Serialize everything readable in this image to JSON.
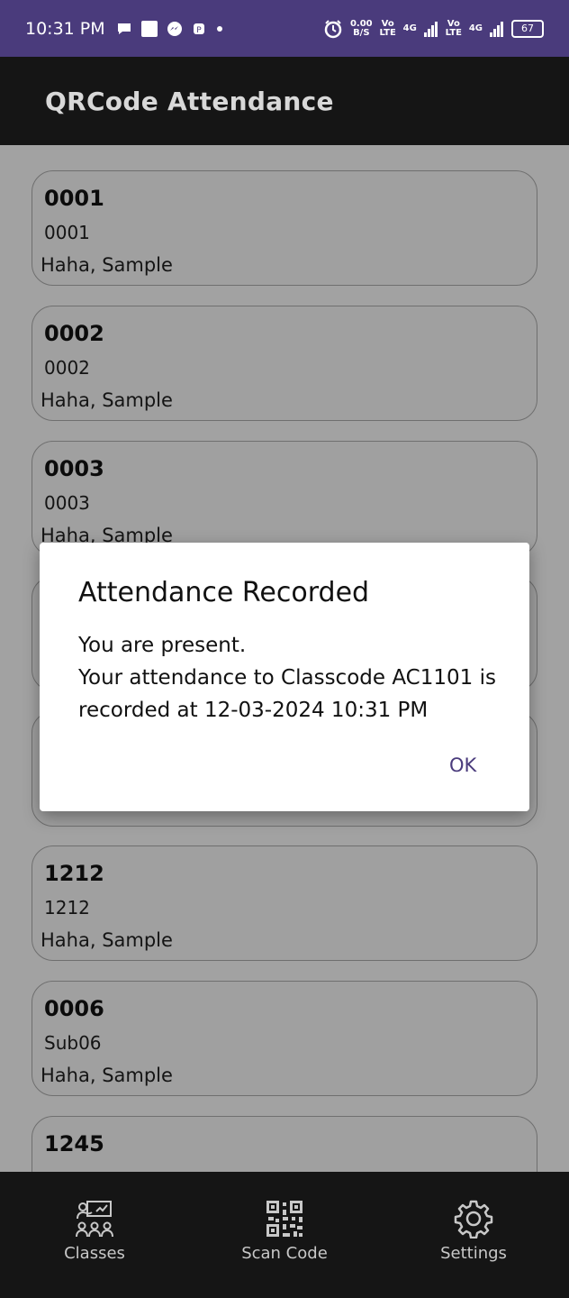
{
  "status_bar": {
    "time": "10:31 PM",
    "speed_value": "0.00",
    "speed_unit": "B/S",
    "volte1": "Vo LTE",
    "net1": "4G",
    "volte2": "Vo LTE",
    "net2": "4G",
    "battery": "67"
  },
  "app_bar": {
    "title": "QRCode Attendance"
  },
  "classes": [
    {
      "code": "0001",
      "subject": "0001",
      "names": "Haha, Sample"
    },
    {
      "code": "0002",
      "subject": "0002",
      "names": "Haha, Sample"
    },
    {
      "code": "0003",
      "subject": "0003",
      "names": "Haha, Sample"
    },
    {
      "code": "1212",
      "subject": "1212",
      "names": "Haha, Sample"
    },
    {
      "code": "0006",
      "subject": "Sub06",
      "names": "Haha, Sample"
    },
    {
      "code": "1245",
      "subject": "",
      "names": ""
    }
  ],
  "dialog": {
    "title": "Attendance Recorded",
    "line1": "You are present.",
    "line2": "Your attendance to Classcode AC1101 is recorded at 12-03-2024 10:31 PM",
    "ok_label": "OK"
  },
  "bottom_nav": {
    "items": [
      {
        "label": "Classes",
        "icon": "classes-icon"
      },
      {
        "label": "Scan Code",
        "icon": "qr-code-icon"
      },
      {
        "label": "Settings",
        "icon": "gear-icon"
      }
    ]
  },
  "colors": {
    "status_bar": "#4a3b7c",
    "app_bar": "#151515",
    "accent": "#4a3b7c",
    "scrim_background": "#a2a2a2"
  }
}
